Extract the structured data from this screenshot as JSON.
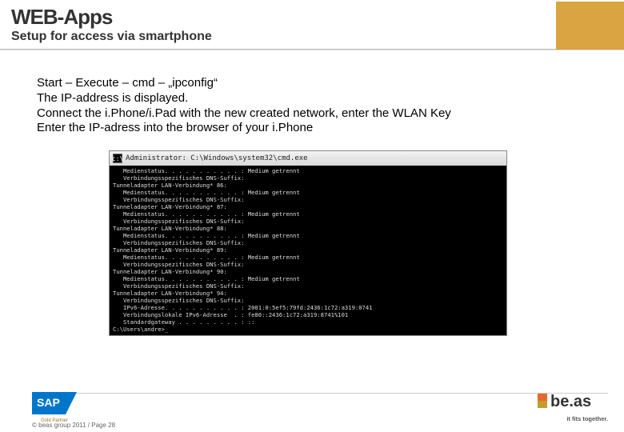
{
  "header": {
    "title": "WEB-Apps",
    "subtitle": "Setup for access via smartphone"
  },
  "instructions": [
    "Start – Execute – cmd – „ipconfig“",
    "The IP-address is displayed.",
    "Connect the i.Phone/i.Pad with the new created network, enter the WLAN Key",
    "Enter the IP-adress into the browser of your i.Phone"
  ],
  "cmd": {
    "title": "Administrator: C:\\Windows\\system32\\cmd.exe",
    "lines": [
      "",
      "   Medienstatus. . . . . . . . . . . : Medium getrennt",
      "   Verbindungsspezifisches DNS-Suffix:",
      "",
      "Tunneladapter LAN-Verbindung* 86:",
      "",
      "   Medienstatus. . . . . . . . . . . : Medium getrennt",
      "   Verbindungsspezifisches DNS-Suffix:",
      "",
      "Tunneladapter LAN-Verbindung* 87:",
      "",
      "   Medienstatus. . . . . . . . . . . : Medium getrennt",
      "   Verbindungsspezifisches DNS-Suffix:",
      "",
      "Tunneladapter LAN-Verbindung* 88:",
      "",
      "   Medienstatus. . . . . . . . . . . : Medium getrennt",
      "   Verbindungsspezifisches DNS-Suffix:",
      "",
      "Tunneladapter LAN-Verbindung* 89:",
      "",
      "   Medienstatus. . . . . . . . . . . : Medium getrennt",
      "   Verbindungsspezifisches DNS-Suffix:",
      "",
      "Tunneladapter LAN-Verbindung* 90:",
      "",
      "   Medienstatus. . . . . . . . . . . : Medium getrennt",
      "   Verbindungsspezifisches DNS-Suffix:",
      "",
      "Tunneladapter LAN-Verbindung* 94:",
      "",
      "   Verbindungsspezifisches DNS-Suffix:",
      "   IPv6-Adresse. . . . . . . . . . . : 2001:0:5ef5:79fd:2436:1c72:a319:0741",
      "   Verbindungslokale IPv6-Adresse  . : fe80::2436:1c72:a319:8741%101",
      "   Standardgateway . . . . . . . . . : ::",
      "",
      "C:\\Users\\andre>_"
    ]
  },
  "footer": {
    "sap_text": "SAP",
    "sap_sub": "Gold Partner",
    "copyright": "© beas group 2011 / Page 28",
    "beas_text": "be.as",
    "beas_tag": "it fits together."
  }
}
